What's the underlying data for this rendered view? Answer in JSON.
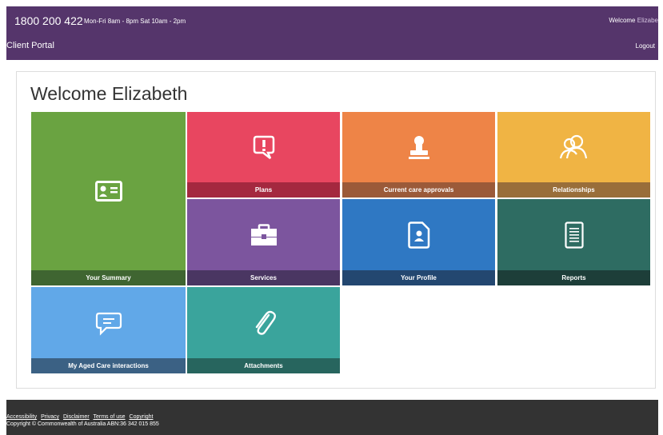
{
  "topbar": {
    "phone": "1800 200 422",
    "hours": "Mon-Fri 8am - 8pm Sat 10am - 2pm",
    "welcome_prefix": "Welcome",
    "welcome_name": "Elizabe",
    "portal_title": "Client Portal",
    "logout_label": "Logout",
    "color": "#55356b"
  },
  "main": {
    "title": "Welcome Elizabeth",
    "tiles": [
      {
        "label": "Your Summary",
        "icon": "id-card-icon",
        "color": "#6aa341",
        "band": "#3f6531"
      },
      {
        "label": "Plans",
        "icon": "alert-bubble-icon",
        "color": "#e84660",
        "band": "#a4283f"
      },
      {
        "label": "Current care approvals",
        "icon": "stamp-icon",
        "color": "#ee8447",
        "band": "#9b5a39"
      },
      {
        "label": "Relationships",
        "icon": "people-icon",
        "color": "#f0b444",
        "band": "#996e3a"
      },
      {
        "label": "Services",
        "icon": "briefcase-icon",
        "color": "#7c559e",
        "band": "#4a3662"
      },
      {
        "label": "Your Profile",
        "icon": "profile-document-icon",
        "color": "#2f78c3",
        "band": "#234770"
      },
      {
        "label": "Reports",
        "icon": "document-lines-icon",
        "color": "#2e6c62",
        "band": "#1d3e39"
      },
      {
        "label": "My Aged Care interactions",
        "icon": "chat-lines-icon",
        "color": "#61a8e8",
        "band": "#3b6184"
      },
      {
        "label": "Attachments",
        "icon": "paperclip-icon",
        "color": "#3aa49c",
        "band": "#27655e"
      }
    ]
  },
  "footer": {
    "links": [
      "Accessibility",
      "Privacy",
      "Disclaimer",
      "Terms of use",
      "Copyright"
    ],
    "copyright": "Copyright © Commonwealth of Australia ABN:36 342 015 855"
  }
}
